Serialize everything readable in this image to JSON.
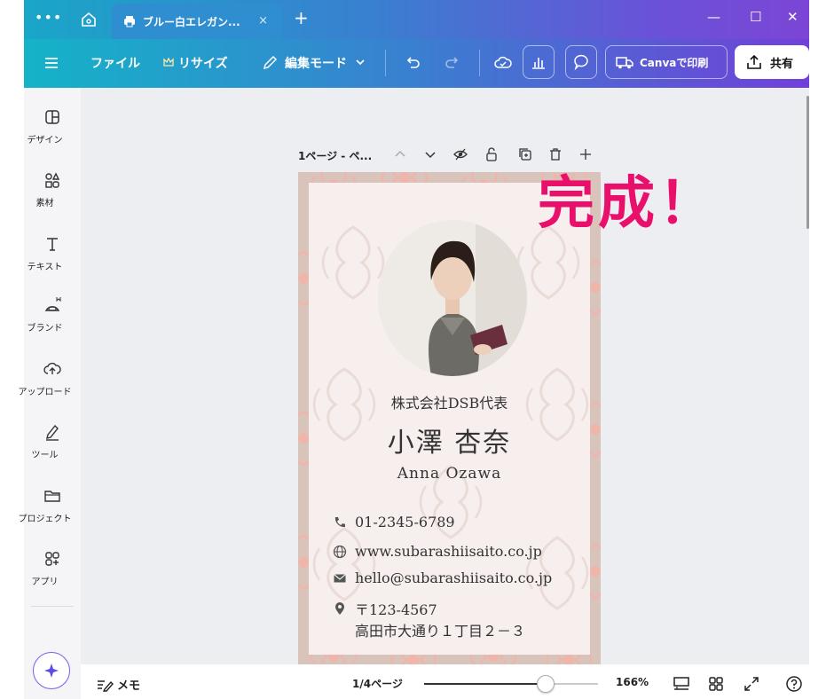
{
  "titlebar": {
    "menu_dots": "•••",
    "tab_title": "ブルー白エレガン...",
    "tab_close": "×",
    "new_tab": "+",
    "win_min": "—",
    "win_max": "☐",
    "win_close": "✕"
  },
  "toolbar": {
    "file_label": "ファイル",
    "resize_label": "リサイズ",
    "edit_mode_label": "編集モード",
    "print_label": "Canvaで印刷",
    "share_label": "共有"
  },
  "sidebar": {
    "items": [
      {
        "label": "デザイン",
        "icon": "design-icon"
      },
      {
        "label": "素材",
        "icon": "elements-icon"
      },
      {
        "label": "テキスト",
        "icon": "text-icon"
      },
      {
        "label": "ブランド",
        "icon": "brand-icon"
      },
      {
        "label": "アップロード",
        "icon": "upload-icon"
      },
      {
        "label": "ツール",
        "icon": "draw-icon"
      },
      {
        "label": "プロジェクト",
        "icon": "folder-icon"
      },
      {
        "label": "アプリ",
        "icon": "apps-icon"
      }
    ]
  },
  "canvas": {
    "page_label": "1ページ - ペ..."
  },
  "card": {
    "company": "株式会社DSB代表",
    "name_jp": "小澤 杏奈",
    "name_en": "Anna Ozawa",
    "phone": "01-2345-6789",
    "website": "www.subarashiisaito.co.jp",
    "email": "hello@subarashiisaito.co.jp",
    "postal": "〒123-4567",
    "address": "高田市大通り１丁目２－３"
  },
  "overlay": {
    "done_text": "完成！"
  },
  "bottombar": {
    "memo_label": "メモ",
    "pages_label": "1/4ページ",
    "zoom_label": "166%",
    "zoom_fraction": 0.7
  },
  "colors": {
    "accent": "#e8106a",
    "card_border": "#d9c4bb",
    "card_bg": "#f6efee"
  }
}
